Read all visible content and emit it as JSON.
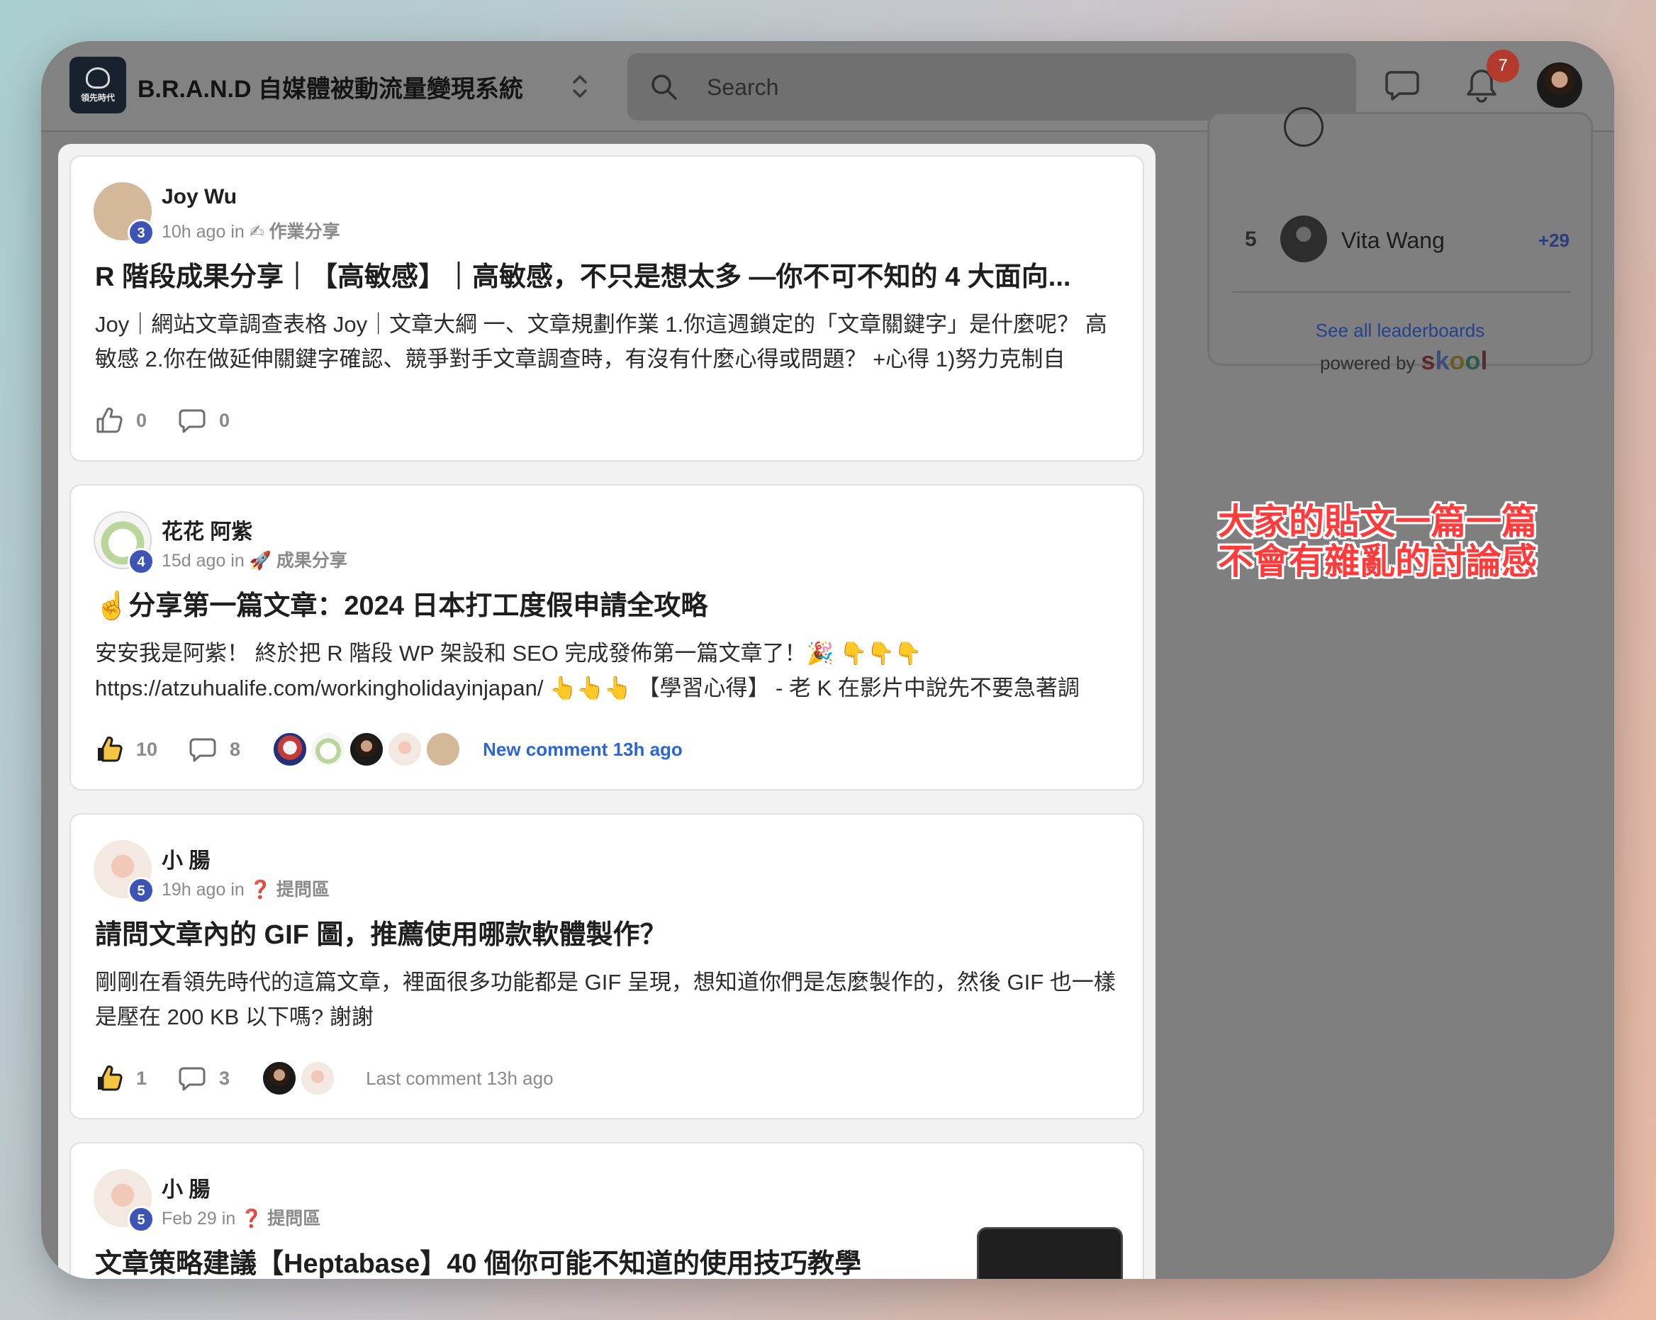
{
  "app": {
    "logo_text": "領先時代",
    "brand_title": "B.R.A.N.D 自媒體被動流量變現系統",
    "search_placeholder": "Search",
    "notification_count": "7"
  },
  "posts": [
    {
      "author": "Joy Wu",
      "level": "3",
      "time": "10h ago in",
      "category_emoji": "✍",
      "category": "作業分享",
      "title": "R 階段成果分享｜【高敏感】｜高敏感，不只是想太多 —你不可不知的 4 大面向...",
      "body": "Joy｜網站文章調查表格 Joy｜文章大綱 一、文章規劃作業 1.你這週鎖定的「文章關鍵字」是什麼呢？ 高敏感 2.你在做延伸關鍵字確認、競爭對手文章調查時，有沒有什麼心得或問題？ +心得 1)努力克制自",
      "likes": "0",
      "comments": "0"
    },
    {
      "author": "花花 阿紫",
      "level": "4",
      "time": "15d ago in",
      "category_emoji": "🚀",
      "category": "成果分享",
      "title": "☝️分享第一篇文章：2024 日本打工度假申請全攻略",
      "body": "安安我是阿紫！ 終於把 R 階段 WP 架設和 SEO 完成發佈第一篇文章了！🎉 👇👇👇 https://atzuhualife.com/workingholidayinjapan/ 👆👆👆 【學習心得】 - 老 K 在影片中說先不要急著調",
      "likes": "10",
      "comments": "8",
      "activity": "New comment 13h ago"
    },
    {
      "author": "小 腸",
      "level": "5",
      "time": "19h ago in",
      "category_emoji": "❓",
      "category": "提問區",
      "title": "請問文章內的 GIF 圖，推薦使用哪款軟體製作？",
      "body": "剛剛在看領先時代的這篇文章，裡面很多功能都是 GIF 呈現，想知道你們是怎麼製作的，然後 GIF 也一樣是壓在 200 KB 以下嗎? 謝謝",
      "likes": "1",
      "comments": "3",
      "activity": "Last comment 13h ago"
    },
    {
      "author": "小 腸",
      "level": "5",
      "time": "Feb 29 in",
      "category_emoji": "❓",
      "category": "提問區",
      "title": "文章策略建議【Heptabase】40 個你可能不知道的使用技巧教學"
    }
  ],
  "leaderboard": {
    "rank": "5",
    "name": "Vita Wang",
    "points": "+29",
    "see_all": "See all leaderboards"
  },
  "powered_by": {
    "label": "powered by",
    "brand": "skool"
  },
  "annotation": {
    "line1": "大家的貼文一篇一篇",
    "line2": "不會有雜亂的討論感"
  },
  "colors": {
    "accent_blue": "#2a66d6",
    "level_badge": "#3d53b5",
    "annotation_red": "#ff3b3b",
    "notification_red": "#b53a2e"
  }
}
